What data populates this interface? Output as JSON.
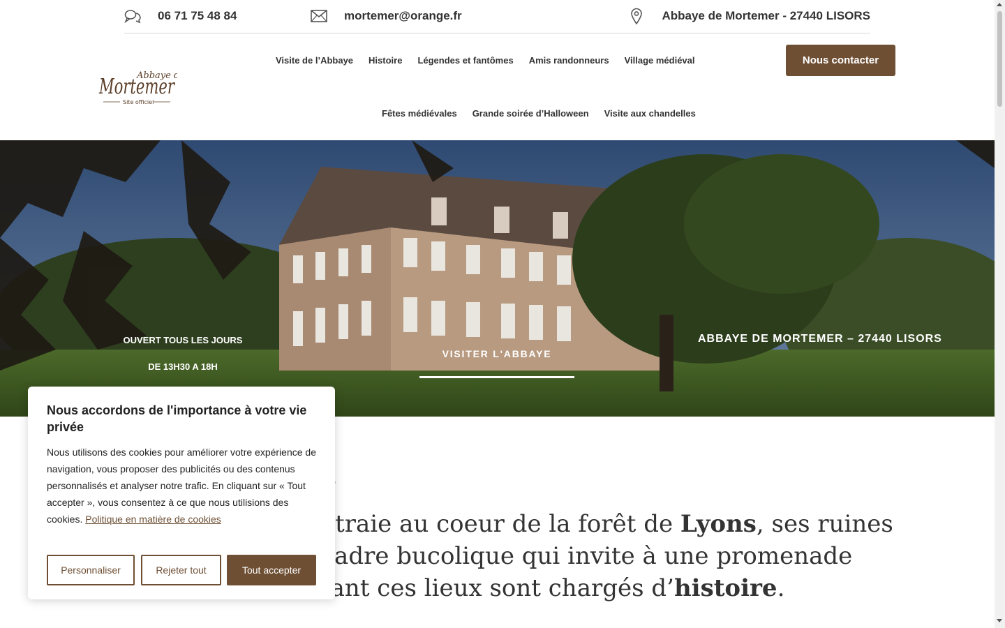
{
  "topbar": {
    "phone": "06 71 75 48 84",
    "email": "mortemer@orange.fr",
    "address": "Abbaye de Mortemer - 27440 LISORS"
  },
  "logo": {
    "line1": "Abbaye de",
    "line2": "Mortemer",
    "line3": "Site officiel"
  },
  "nav": {
    "row1": [
      "Visite de l’Abbaye",
      "Histoire",
      "Légendes et fantômes",
      "Amis randonneurs",
      "Village médiéval"
    ],
    "row2": [
      "Fêtes médiévales",
      "Grande soirée d’Halloween",
      "Visite aux chandelles"
    ]
  },
  "cta_label": "Nous contacter",
  "hero": {
    "open_line1": "OUVERT TOUS LES JOURS",
    "open_line2": "DE 13H30 A 18H",
    "visit_label": "VISITER L'ABBAYE",
    "address": "ABBAYE DE MORTEMER – 27440 LISORS"
  },
  "intro": {
    "line1_a": "ètraie au coeur de la forêt de ",
    "line1_b": "Lyons",
    "line1_c": ", ses ruines",
    "line2": "cadre bucolique qui invite à une promenade",
    "line3_a": "tant ces lieux sont chargés d’",
    "line3_b": "histoire",
    "line3_c": "."
  },
  "cookie": {
    "title": "Nous accordons de l'importance à votre vie privée",
    "body": "Nous utilisons des cookies pour améliorer votre expérience de navigation, vous proposer des publicités ou des contenus personnalisés et analyser notre trafic. En cliquant sur « Tout accepter », vous consentez à ce que nous utilisions des cookies.",
    "policy_link": "Politique en matière de cookies",
    "btn_customize": "Personnaliser",
    "btn_reject": "Rejeter tout",
    "btn_accept": "Tout accepter"
  },
  "colors": {
    "brand_brown": "#6e4f34",
    "sky": "#3b5377",
    "grass": "#4c6a2a"
  }
}
